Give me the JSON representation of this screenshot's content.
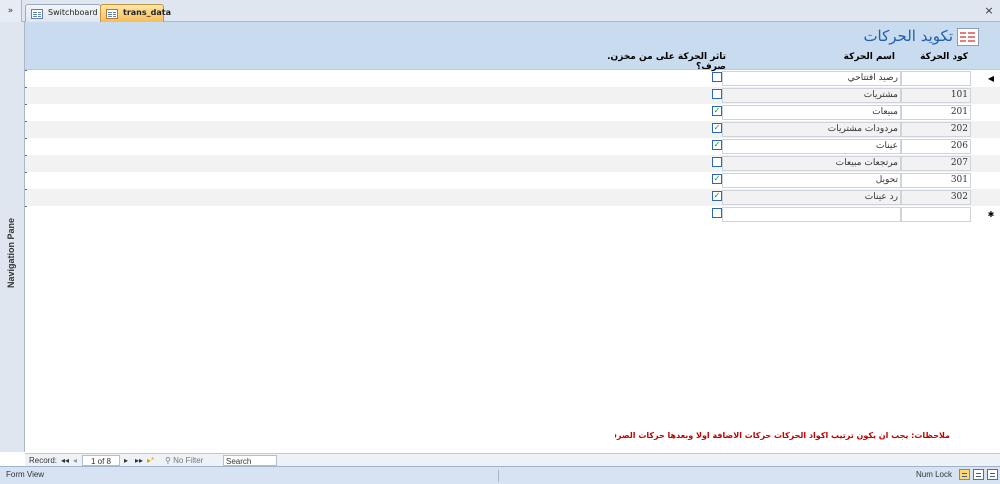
{
  "window": {
    "nav_toggle": "»",
    "tabs": [
      {
        "label": "Switchboard"
      },
      {
        "label": "trans_data"
      }
    ],
    "close": "×"
  },
  "nav_pane": {
    "label": "Navigation Pane"
  },
  "form": {
    "title": "تكويد الحركات",
    "columns": {
      "code": "كود الحركة",
      "name": "اسم الحركة",
      "flag": "تاثر الحركة على من مخزن. صرف؟"
    },
    "rows": [
      {
        "code": "",
        "name": "رصيد افتتاحي",
        "checked": false
      },
      {
        "code": "101",
        "name": "مشتريات",
        "checked": false
      },
      {
        "code": "201",
        "name": "مبيعات",
        "checked": true
      },
      {
        "code": "202",
        "name": "مردودات مشتريات",
        "checked": true
      },
      {
        "code": "206",
        "name": "عينات",
        "checked": true
      },
      {
        "code": "207",
        "name": "مرتجعات مبيعات",
        "checked": false
      },
      {
        "code": "301",
        "name": "تحويل",
        "checked": true
      },
      {
        "code": "302",
        "name": "رد عينات",
        "checked": true
      },
      {
        "code": "",
        "name": "",
        "checked": false
      }
    ],
    "note": "ملاحظات: يجب ان يكون ترتيب اكواد الحركات  حركات الاضافة اولا وبعدها حركات الصرف"
  },
  "record_navigation": {
    "label": "Record:",
    "first": "◂◂",
    "prev": "◂",
    "current": "1 of 8",
    "next": "▸",
    "last": "▸▸",
    "new": "▸*",
    "filter": "No Filter",
    "search": "Search"
  },
  "status_bar": {
    "view": "Form View",
    "num_lock": "Num Lock"
  },
  "colors": {
    "header_bg": "#c9dbef",
    "title": "#1f5fb0",
    "note": "#c40000"
  }
}
